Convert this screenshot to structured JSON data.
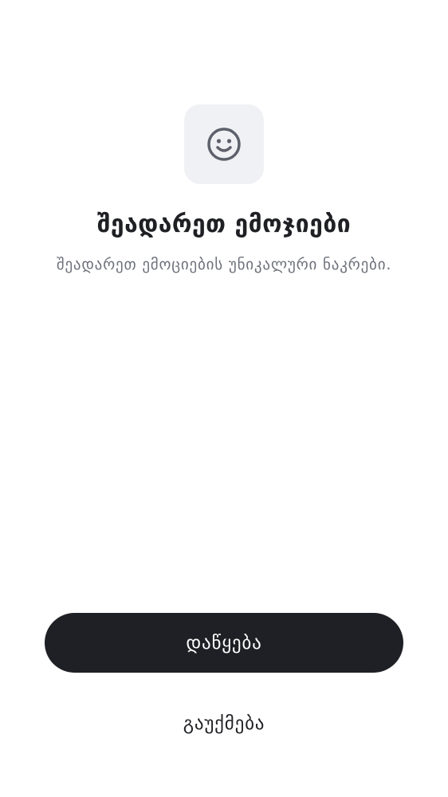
{
  "header": {
    "icon": "smile-icon",
    "title": "შეადარეთ ემოჯიები",
    "subtitle": "შეადარეთ ემოციების უნიკალური ნაკრები."
  },
  "actions": {
    "primary_label": "დაწყება",
    "secondary_label": "გაუქმება"
  },
  "colors": {
    "background": "#ffffff",
    "icon_tile": "#f0f1f4",
    "icon": "#5d616b",
    "primary_button": "#1f2025",
    "title_text": "#1f2024",
    "subtitle_text": "#6e717b"
  }
}
